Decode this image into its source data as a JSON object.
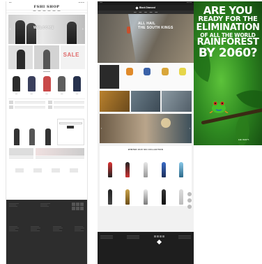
{
  "fashion": {
    "logo": "FSHI SHOP",
    "hero_title": "WELCOME",
    "sale_label": "SALE"
  },
  "outdoor": {
    "brand": "Black Diamond",
    "hero_title_line1": "ALL HAIL",
    "hero_title_line2": "THE SOUTH KINGS",
    "collection_title": "WINTER 2015 SKI COLLECTION"
  },
  "poster": {
    "line1": "ARE YOU",
    "line2": "READY FOR THE",
    "line3": "ELIMINATION",
    "line4": "OF ALL THE WORLD",
    "line5": "RAINFOREST",
    "line6": "BY 2060?",
    "tagline": "HE ISN'T."
  },
  "colors": {
    "poster_green": "#2f8a21",
    "outdoor_dark": "#1e1e1e",
    "fashion_footer": "#2d2d2d",
    "sale_red": "#e06b6b"
  }
}
